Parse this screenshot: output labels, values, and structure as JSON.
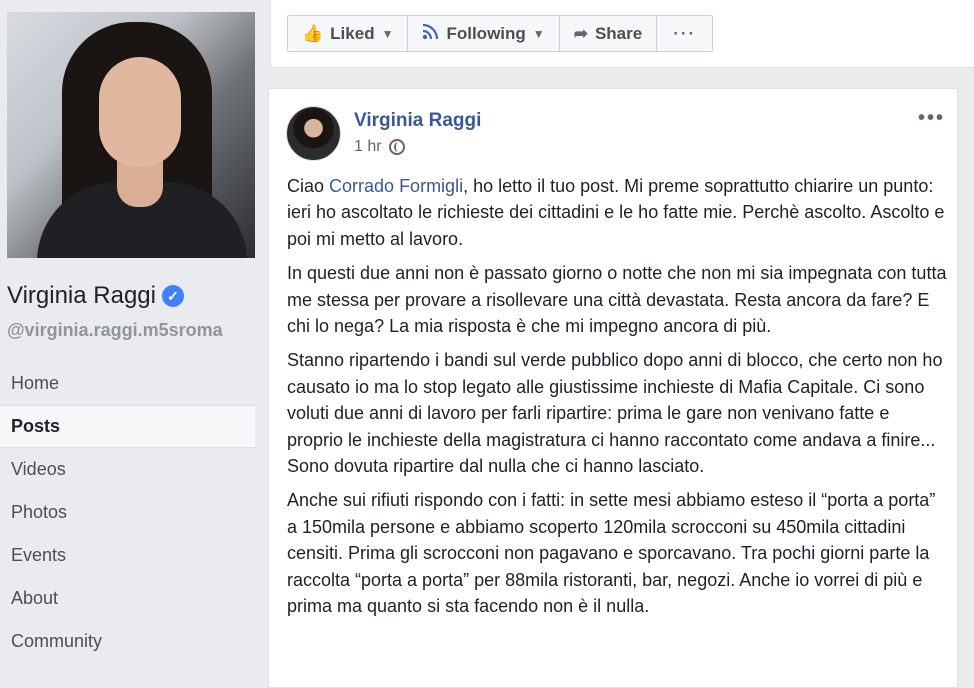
{
  "sidebar": {
    "page_name": "Virginia Raggi",
    "handle": "@virginia.raggi.m5sroma",
    "nav": [
      {
        "label": "Home",
        "active": false
      },
      {
        "label": "Posts",
        "active": true
      },
      {
        "label": "Videos",
        "active": false
      },
      {
        "label": "Photos",
        "active": false
      },
      {
        "label": "Events",
        "active": false
      },
      {
        "label": "About",
        "active": false
      },
      {
        "label": "Community",
        "active": false
      }
    ]
  },
  "actions": {
    "liked": "Liked",
    "following": "Following",
    "share": "Share",
    "more": "···"
  },
  "post": {
    "author": "Virginia Raggi",
    "time": "1 hr",
    "menu": "•••",
    "p1_prefix": "Ciao ",
    "p1_link": "Corrado Formigli",
    "p1_rest": ", ho letto il tuo post. Mi preme soprattutto chiarire un punto: ieri ho ascoltato le richieste dei cittadini e le ho fatte mie. Perchè ascolto. Ascolto e poi mi metto al lavoro.",
    "p2": "In questi due anni non è passato giorno o notte che non mi sia impegnata con tutta me stessa per provare a risollevare una città devastata. Resta ancora da fare? E chi lo nega? La mia risposta è che mi impegno ancora di più.",
    "p3": "Stanno ripartendo i bandi sul verde pubblico dopo anni di blocco, che certo non ho causato io ma lo stop legato alle giustissime inchieste di Mafia Capitale. Ci sono voluti due anni di lavoro per farli ripartire: prima le gare non venivano fatte e proprio le inchieste della magistratura ci hanno raccontato come andava a finire... Sono dovuta ripartire dal nulla che ci hanno lasciato.",
    "p4": "Anche sui rifiuti rispondo con i fatti: in sette mesi abbiamo esteso il “porta a porta” a 150mila persone e abbiamo scoperto 120mila scrocconi su 450mila cittadini censiti. Prima gli scrocconi non pagavano e sporcavano. Tra pochi giorni parte la raccolta “porta a porta” per 88mila ristoranti, bar, negozi. Anche io vorrei di più e prima ma quanto si sta facendo non è il nulla."
  }
}
